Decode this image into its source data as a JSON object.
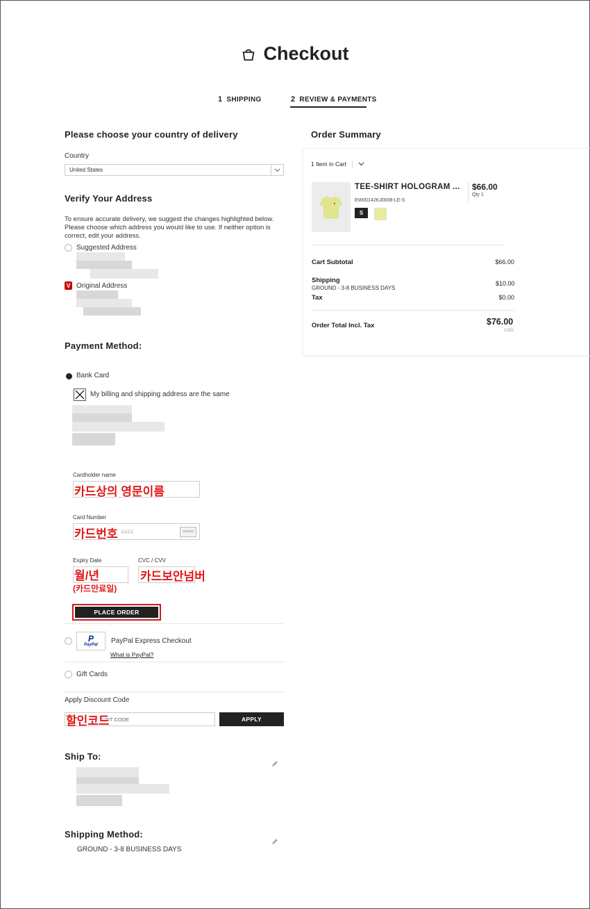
{
  "header": {
    "title": "Checkout",
    "steps": [
      {
        "num": "1",
        "label": "SHIPPING"
      },
      {
        "num": "2",
        "label": "REVIEW & PAYMENTS"
      }
    ]
  },
  "delivery": {
    "heading": "Please choose your country of delivery",
    "country_label": "Country",
    "country_value": "United States"
  },
  "verify": {
    "heading": "Verify Your Address",
    "paragraph": "To ensure accurate delivery, we suggest the changes highlighted below. Please choose which address you would like to use. If neither option is correct, edit your address.",
    "suggested_label": "Suggested Address",
    "original_label": "Original Address"
  },
  "payment": {
    "heading": "Payment Method:",
    "bank_card_label": "Bank Card",
    "same_address_label": "My billing and shipping address are the same",
    "cardholder_label": "Cardholder name",
    "cardholder_note": "카드상의 영문이름",
    "card_number_label": "Card Number",
    "card_number_placeholder": "4444",
    "card_number_note": "카드번호",
    "expiry_label": "Expiry Date",
    "expiry_note": "월/년",
    "expiry_note_sub": "(카드만료일)",
    "cvc_label": "CVC / CVV",
    "cvc_note": "카드보안넘버",
    "place_order": "PLACE ORDER",
    "paypal_label": "PayPal Express Checkout",
    "paypal_logo": "PayPal",
    "paypal_link": "What is PayPal?",
    "gift_cards_label": "Gift Cards"
  },
  "discount": {
    "heading": "Apply Discount Code",
    "placeholder": "UNT CODE",
    "note": "할인코드",
    "apply": "APPLY"
  },
  "ship_to": {
    "heading": "Ship To:"
  },
  "shipping_method": {
    "heading": "Shipping Method:",
    "value": "GROUND - 3-8 BUSINESS DAYS"
  },
  "summary": {
    "heading": "Order Summary",
    "items_in_cart": "1 Item in Cart",
    "product": {
      "name": "TEE-SHIRT HOLOGRAM ...",
      "sku": "EW00142KJ0008-LE-S",
      "price": "$66.00",
      "qty": "Qty 1",
      "size": "S",
      "color": "#e8ec9c"
    },
    "cart_subtotal_label": "Cart Subtotal",
    "cart_subtotal": "$66.00",
    "shipping_label": "Shipping",
    "shipping_method": "GROUND - 3-8 BUSINESS DAYS",
    "shipping_value": "$10.00",
    "tax_label": "Tax",
    "tax_value": "$0.00",
    "order_total_label": "Order Total Incl. Tax",
    "order_total": "$76.00",
    "currency": "USD"
  },
  "colors": {
    "accent_dark": "#222222",
    "annotation_red": "#e01919"
  }
}
